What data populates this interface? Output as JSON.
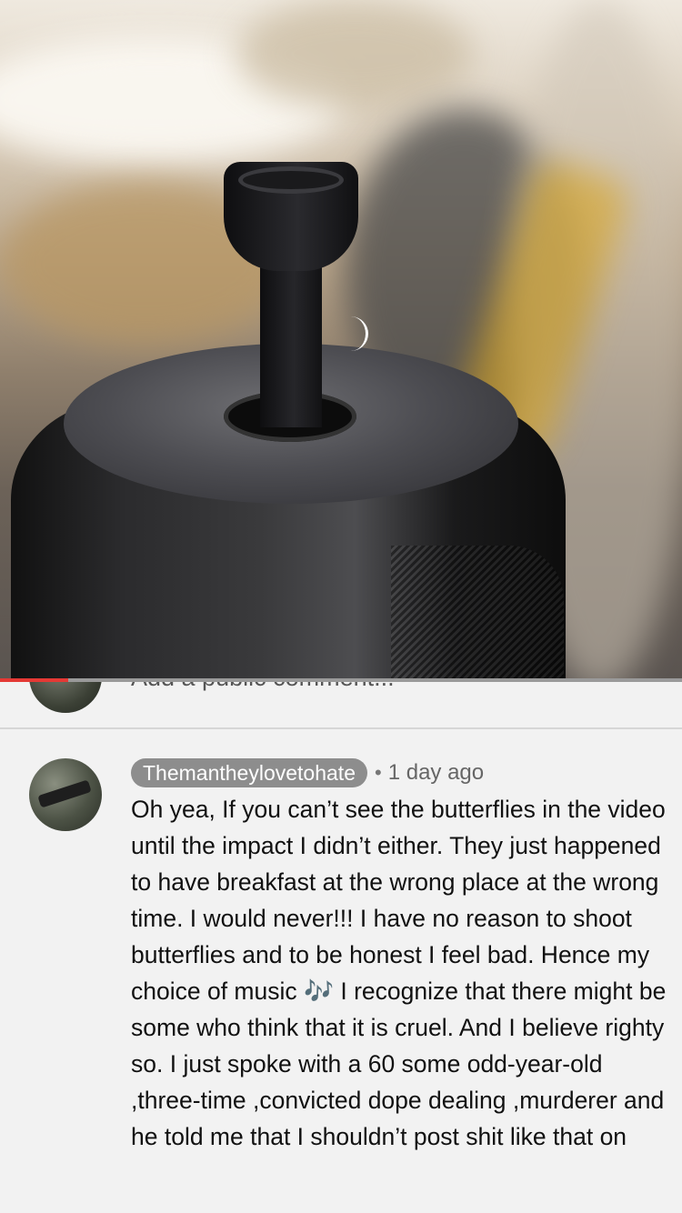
{
  "video": {
    "progress_fraction": 0.1,
    "progress_color": "#e53935",
    "loading_indicator": "spinner-icon"
  },
  "add_comment": {
    "placeholder": "Add a public comment..."
  },
  "comment": {
    "author": "Themantheylovetohate",
    "separator": "•",
    "time": "1 day ago",
    "text": "Oh yea, If you can’t see the butterflies in the video until the impact I didn’t either. They just happened to have breakfast at the wrong place at the wrong time. I would never!!! I have no reason to shoot butterflies and to be honest I feel bad. Hence my choice of music 🎶 I recognize that there might be some who think that it is cruel. And I believe righty so. I just spoke with a 60 some odd-year-old ,three-time ,convicted dope dealing ,murderer and he told me that I shouldn’t post shit like that on"
  }
}
